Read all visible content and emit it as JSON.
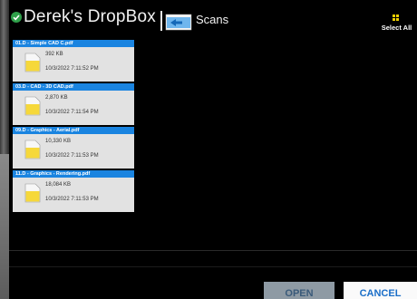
{
  "header": {
    "title": "Derek's DropBox",
    "status_icon": "check-circle-icon",
    "folder_icon": "folder-back-icon",
    "folder_label": "Scans",
    "select_all_icon": "grid-icon",
    "select_all_label": "Select All"
  },
  "files": [
    {
      "name": "01.D - Simple CAD C.pdf",
      "size": "392 KB",
      "date": "10/3/2022 7:11:52 PM",
      "icon": "document-icon"
    },
    {
      "name": "03.D - CAD - 3D CAD.pdf",
      "size": "2,870 KB",
      "date": "10/3/2022 7:11:54 PM",
      "icon": "document-icon"
    },
    {
      "name": "09.D - Graphics - Aerial.pdf",
      "size": "10,330 KB",
      "date": "10/3/2022 7:11:53 PM",
      "icon": "document-icon"
    },
    {
      "name": "11.D - Graphics - Rendering.pdf",
      "size": "18,084 KB",
      "date": "10/3/2022 7:11:53 PM",
      "icon": "document-icon"
    }
  ],
  "footer": {
    "open_label": "OPEN",
    "cancel_label": "CANCEL"
  },
  "colors": {
    "accent": "#1a84e0",
    "status_green": "#2fa04a",
    "select_all_yellow": "#f0d000"
  }
}
